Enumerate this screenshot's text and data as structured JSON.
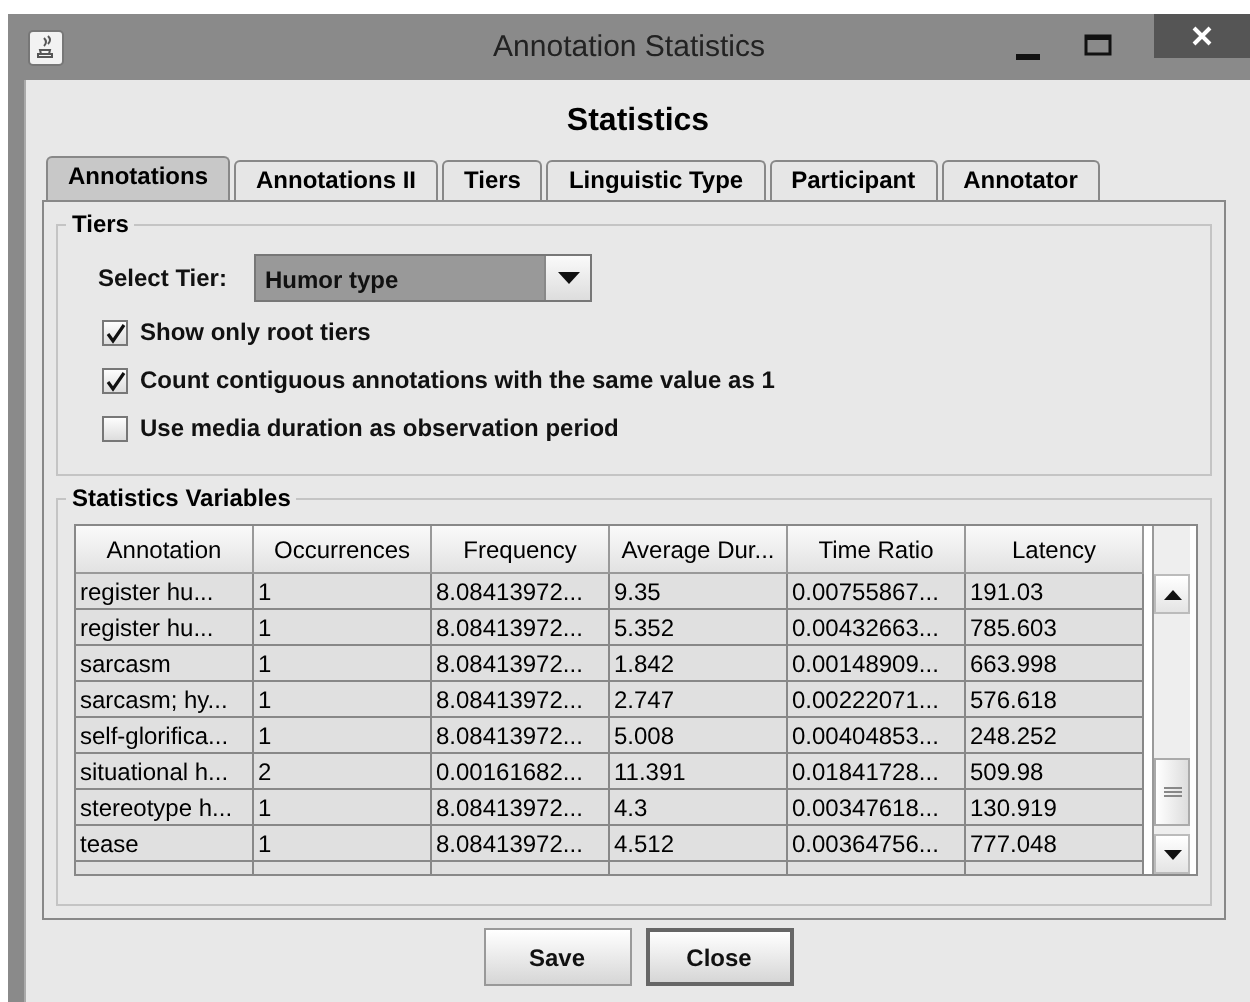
{
  "window": {
    "title": "Annotation Statistics"
  },
  "heading": "Statistics",
  "tabs": [
    {
      "label": "Annotations",
      "selected": true
    },
    {
      "label": "Annotations II",
      "selected": false
    },
    {
      "label": "Tiers",
      "selected": false
    },
    {
      "label": "Linguistic Type",
      "selected": false
    },
    {
      "label": "Participant",
      "selected": false
    },
    {
      "label": "Annotator",
      "selected": false
    }
  ],
  "tiers_group": {
    "title": "Tiers",
    "select_label": "Select Tier:",
    "select_value": "Humor type",
    "checkboxes": [
      {
        "label": "Show only root tiers",
        "checked": true
      },
      {
        "label": "Count contiguous annotations with the same value as 1",
        "checked": true
      },
      {
        "label": "Use media duration as observation period",
        "checked": false
      }
    ]
  },
  "variables_group": {
    "title": "Statistics Variables",
    "table": {
      "columns": [
        "Annotation",
        "Occurrences",
        "Frequency",
        "Average Dur...",
        "Time Ratio",
        "Latency"
      ],
      "rows": [
        [
          "register hu...",
          "1",
          "8.08413972...",
          "9.35",
          "0.00755867...",
          "191.03"
        ],
        [
          "register hu...",
          "1",
          "8.08413972...",
          "5.352",
          "0.00432663...",
          "785.603"
        ],
        [
          "sarcasm",
          "1",
          "8.08413972...",
          "1.842",
          "0.00148909...",
          "663.998"
        ],
        [
          "sarcasm; hy...",
          "1",
          "8.08413972...",
          "2.747",
          "0.00222071...",
          "576.618"
        ],
        [
          "self-glorifica...",
          "1",
          "8.08413972...",
          "5.008",
          "0.00404853...",
          "248.252"
        ],
        [
          "situational h...",
          "2",
          "0.00161682...",
          "11.391",
          "0.01841728...",
          "509.98"
        ],
        [
          "stereotype h...",
          "1",
          "8.08413972...",
          "4.3",
          "0.00347618...",
          "130.919"
        ],
        [
          "tease",
          "1",
          "8.08413972...",
          "4.512",
          "0.00364756...",
          "777.048"
        ]
      ]
    }
  },
  "buttons": [
    "Save",
    "Close"
  ]
}
